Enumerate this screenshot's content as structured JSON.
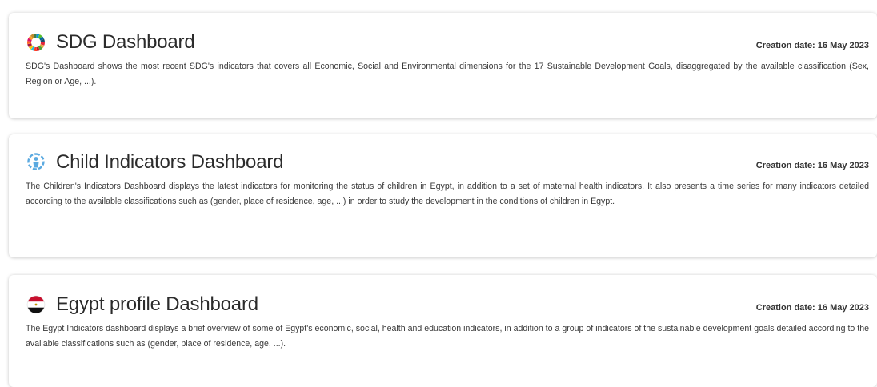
{
  "dashboards": [
    {
      "title": "SDG Dashboard",
      "icon": "sdg-wheel-icon",
      "creation_date": "Creation date: 16 May 2023",
      "description": "SDG's Dashboard shows the most recent SDG's indicators that covers all Economic, Social and Environmental dimensions for the 17 Sustainable Development Goals, disaggregated by the available classification (Sex, Region or Age, ...)."
    },
    {
      "title": "Child Indicators Dashboard",
      "icon": "child-icon",
      "creation_date": "Creation date: 16 May 2023",
      "description": "The Children's Indicators Dashboard displays the latest indicators for monitoring the status of children in Egypt, in addition to a set of maternal health indicators. It also presents a time series for many indicators detailed according to the available classifications such as (gender, place of residence, age, ...) in order to study the development in the conditions of children in Egypt."
    },
    {
      "title": "Egypt profile Dashboard",
      "icon": "egypt-flag-icon",
      "creation_date": "Creation date: 16 May 2023",
      "description": "The Egypt Indicators dashboard displays a brief overview of some of Egypt's economic, social, health and education indicators, in addition to a group of indicators of the sustainable development goals detailed according to the available classifications such as (gender, place of residence, age, ...)."
    }
  ],
  "colors": {
    "child_icon": "#5aa9e0",
    "flag_red": "#c8102e",
    "flag_black": "#111111"
  }
}
